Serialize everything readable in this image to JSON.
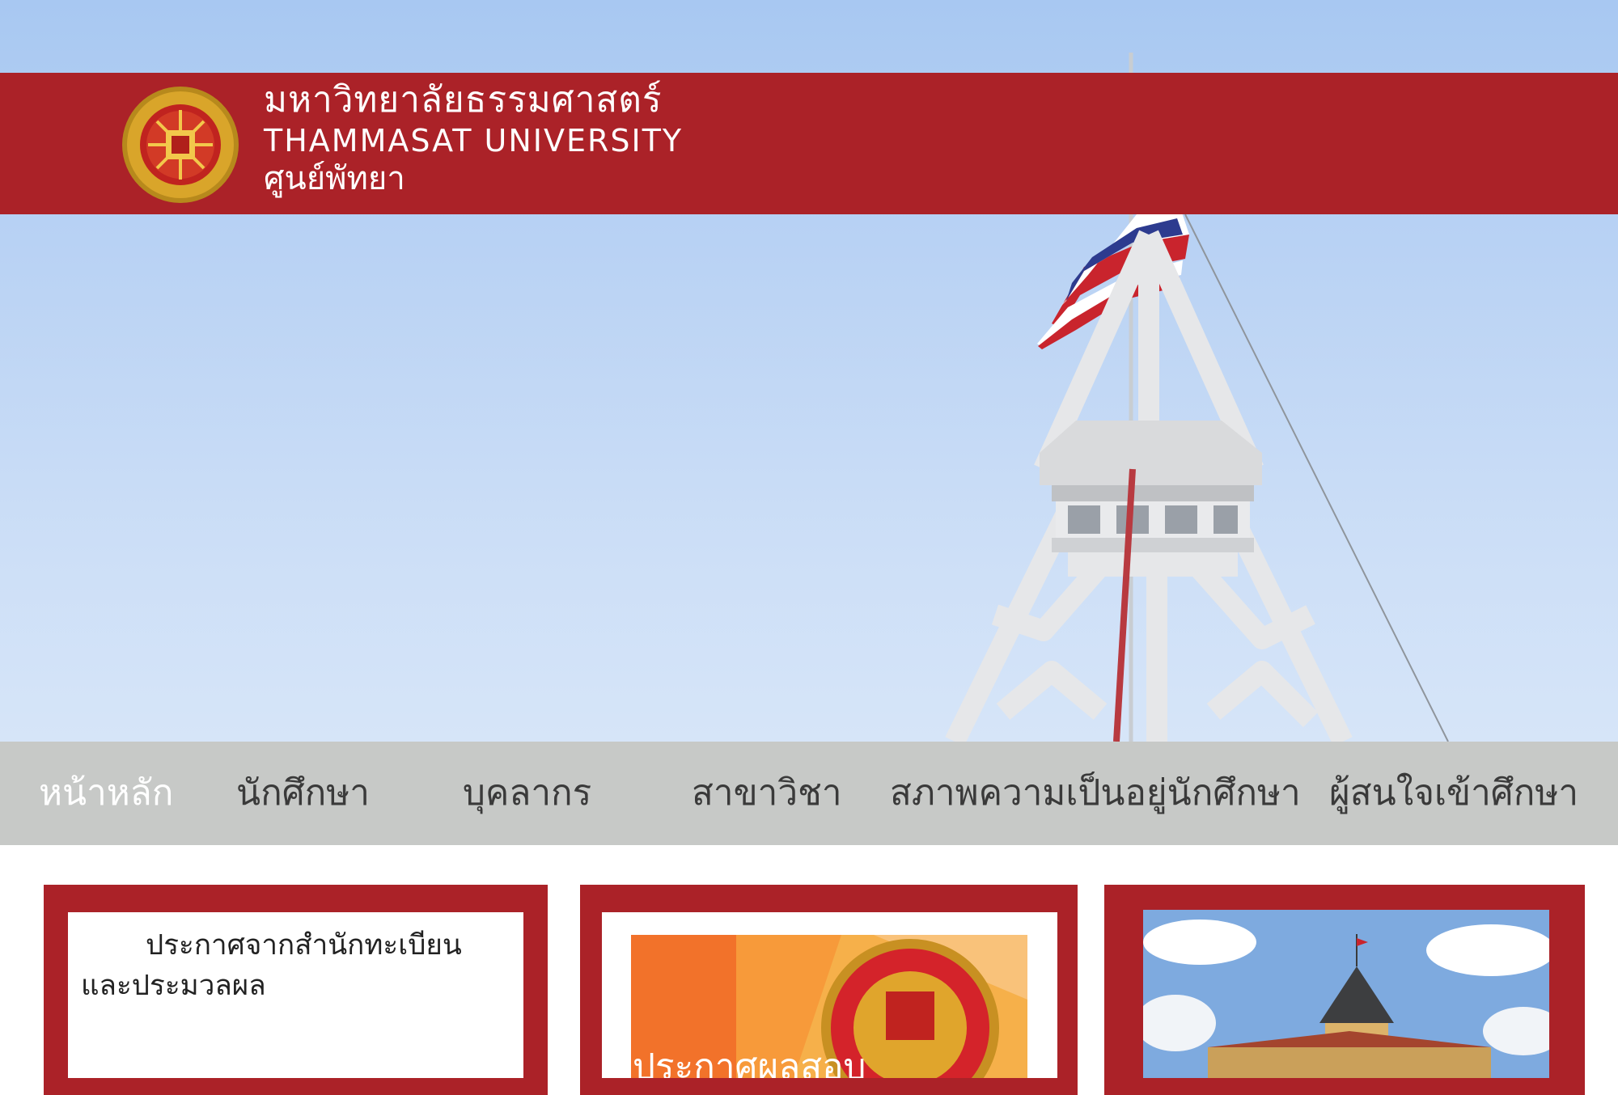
{
  "header": {
    "thai_name": "มหาวิทยาลัยธรรมศาสตร์",
    "english_name": "THAMMASAT UNIVERSITY",
    "campus": "ศูนย์พัทยา",
    "logo_icon": "university-seal-icon"
  },
  "nav": {
    "items": [
      {
        "label": "หน้าหลัก",
        "active": true
      },
      {
        "label": "นักศึกษา",
        "active": false
      },
      {
        "label": "บุคลากร",
        "active": false
      },
      {
        "label": "สาขาวิชา",
        "active": false
      },
      {
        "label": "สภาพความเป็นอยู่นักศึกษา",
        "active": false
      },
      {
        "label": "ผู้สนใจเข้าศึกษา",
        "active": false
      }
    ]
  },
  "cards": {
    "notice_text": "ประกาศจากสำนักทะเบียนและประมวลผล",
    "announcement_caption": "ประกาศผลสอบ"
  },
  "colors": {
    "brand_red": "#ab2228",
    "nav_gray": "#c7c9c7",
    "sky_blue": "#b8d2f4"
  }
}
